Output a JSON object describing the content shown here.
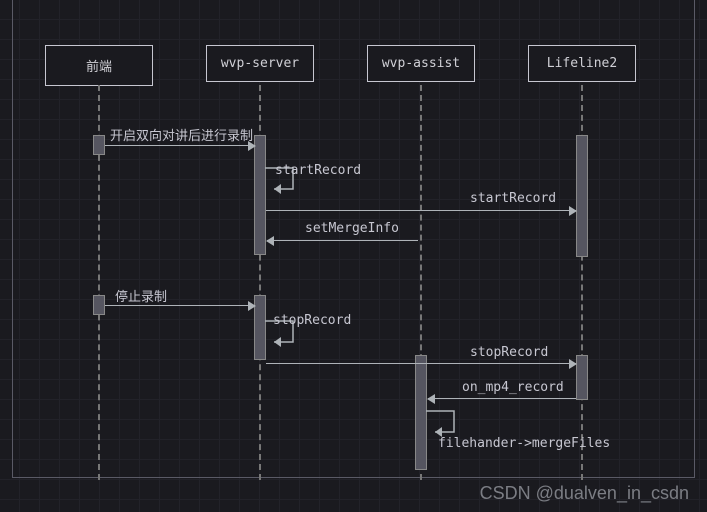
{
  "chart_data": {
    "type": "sequence-diagram",
    "participants": [
      "前端",
      "wvp-server",
      "wvp-assist",
      "Lifeline2"
    ],
    "messages": [
      {
        "from": "前端",
        "to": "wvp-server",
        "label": "开启双向对讲后进行录制",
        "kind": "call"
      },
      {
        "from": "wvp-server",
        "to": "wvp-server",
        "label": "startRecord",
        "kind": "self"
      },
      {
        "from": "wvp-server",
        "to": "Lifeline2",
        "label": "startRecord",
        "kind": "call"
      },
      {
        "from": "wvp-assist",
        "to": "wvp-server",
        "label": "setMergeInfo",
        "kind": "call"
      },
      {
        "from": "前端",
        "to": "wvp-server",
        "label": "停止录制",
        "kind": "call"
      },
      {
        "from": "wvp-server",
        "to": "wvp-server",
        "label": "stopRecord",
        "kind": "self"
      },
      {
        "from": "wvp-server",
        "to": "Lifeline2",
        "label": "stopRecord",
        "kind": "call"
      },
      {
        "from": "Lifeline2",
        "to": "wvp-assist",
        "label": "on_mp4_record",
        "kind": "call"
      },
      {
        "from": "wvp-assist",
        "to": "wvp-assist",
        "label": "filehander->mergeFiles",
        "kind": "self"
      }
    ]
  },
  "participants": {
    "p0": "前端",
    "p1": "wvp-server",
    "p2": "wvp-assist",
    "p3": "Lifeline2"
  },
  "labels": {
    "m0": "开启双向对讲后进行录制",
    "m1": "startRecord",
    "m2": "startRecord",
    "m3": "setMergeInfo",
    "m4": "停止录制",
    "m5": "stopRecord",
    "m6": "stopRecord",
    "m7": "on_mp4_record",
    "m8": "filehander->mergeFiles"
  },
  "watermark": "CSDN @dualven_in_csdn"
}
